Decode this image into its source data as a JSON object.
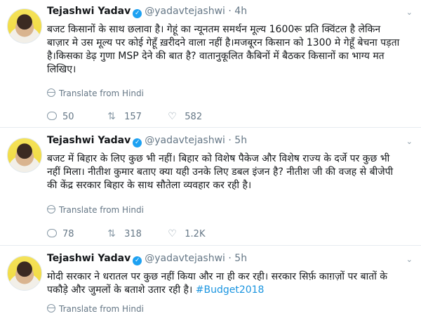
{
  "tweets": [
    {
      "name": "Tejashwi Yadav",
      "handle": "@yadavtejashwi",
      "sep": "·",
      "time": "4h",
      "text": "बजट किसानों के साथ छलावा है। गेहूं का न्यूनतम समर्थन मूल्य 1600रू प्रति क्विंटल है लेकिन बाज़ार मे उस मूल्य पर कोई गेहूँ ख़रीदने वाला नहीं है।मजबूरन किसान को 1300 मे गेहूँ बेचना पड़ता है।किसका डेढ़ गुणा MSP देने की बात है? वातानुकूलित कैबिनों में बैठकर किसानों का भाग्य मत लिखिए।",
      "translate": "Translate from Hindi",
      "replies": "50",
      "retweets": "157",
      "likes": "582"
    },
    {
      "name": "Tejashwi Yadav",
      "handle": "@yadavtejashwi",
      "sep": "·",
      "time": "5h",
      "text": "बजट में बिहार के लिए कुछ भी नहीं। बिहार को  विशेष पैकेज और विशेष राज्य के दर्जे पर कुछ भी नहीं मिला। नीतीश कुमार बताए क्या यही उनके लिए डबल इंजन है? नीतीश जी की वजह से बीजेपी की केंद्र सरकार बिहार के साथ सौतेला व्यवहार कर रही है।",
      "translate": "Translate from Hindi",
      "replies": "78",
      "retweets": "318",
      "likes": "1.2K"
    },
    {
      "name": "Tejashwi Yadav",
      "handle": "@yadavtejashwi",
      "sep": "·",
      "time": "5h",
      "text": "मोदी सरकार ने धरातल पर कुछ नहीं किया और ना ही कर रही। सरकार सिर्फ़ काग़ज़ों पर बातों के पकौड़े और जुमलों के बताशे उतार रही है। ",
      "hashtag": "#Budget2018",
      "translate": "Translate from Hindi"
    }
  ],
  "colors": {
    "link": "#1b95e0",
    "verified": "#1da1f2",
    "muted": "#657786",
    "divider": "#e6ecf0"
  },
  "icons": {
    "verified": "verified-badge-icon",
    "more": "chevron-down-icon",
    "translate": "globe-icon",
    "reply": "reply-icon",
    "retweet": "retweet-icon",
    "like": "heart-icon"
  }
}
